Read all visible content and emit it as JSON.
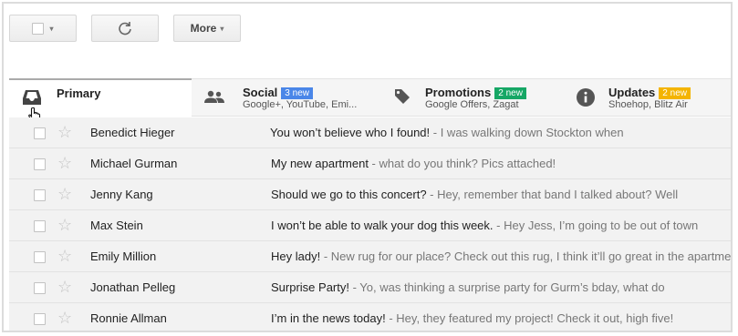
{
  "toolbar": {
    "more_label": "More",
    "caret": "▾"
  },
  "tabs": [
    {
      "name": "primary",
      "label": "Primary",
      "subtitle": "",
      "badge": "",
      "badge_color": "",
      "icon": "inbox-icon"
    },
    {
      "name": "social",
      "label": "Social",
      "subtitle": "Google+, YouTube, Emi...",
      "badge": "3 new",
      "badge_color": "#4a86e8",
      "icon": "people-icon"
    },
    {
      "name": "promotions",
      "label": "Promotions",
      "subtitle": "Google Offers, Zagat",
      "badge": "2 new",
      "badge_color": "#16a765",
      "icon": "tag-icon"
    },
    {
      "name": "updates",
      "label": "Updates",
      "subtitle": "Shoehop, Blitz Air",
      "badge": "2 new",
      "badge_color": "#f4b400",
      "icon": "info-icon"
    }
  ],
  "emails": [
    {
      "sender": "Benedict Hieger",
      "subject": "You won’t believe who I found!",
      "snippet": " - I was walking down Stockton when"
    },
    {
      "sender": "Michael Gurman",
      "subject": "My new apartment",
      "snippet": "  - what do you think? Pics attached!"
    },
    {
      "sender": "Jenny Kang",
      "subject": "Should we go to this concert?",
      "snippet": "  - Hey, remember that band I talked about? Well"
    },
    {
      "sender": "Max Stein",
      "subject": "I won’t be able to walk your dog this week.",
      "snippet": "  - Hey Jess, I’m going to be out of town"
    },
    {
      "sender": "Emily Million",
      "subject": "Hey lady!",
      "snippet": "  - New rug for our place? Check out this rug, I think it’ll go great in the apartme"
    },
    {
      "sender": "Jonathan Pelleg",
      "subject": "Surprise Party!",
      "snippet": " - Yo, was thinking a surprise party for Gurm’s bday, what do"
    },
    {
      "sender": "Ronnie Allman",
      "subject": "I’m in the news today!",
      "snippet": " - Hey, they featured my project! Check it out, high five!"
    }
  ]
}
